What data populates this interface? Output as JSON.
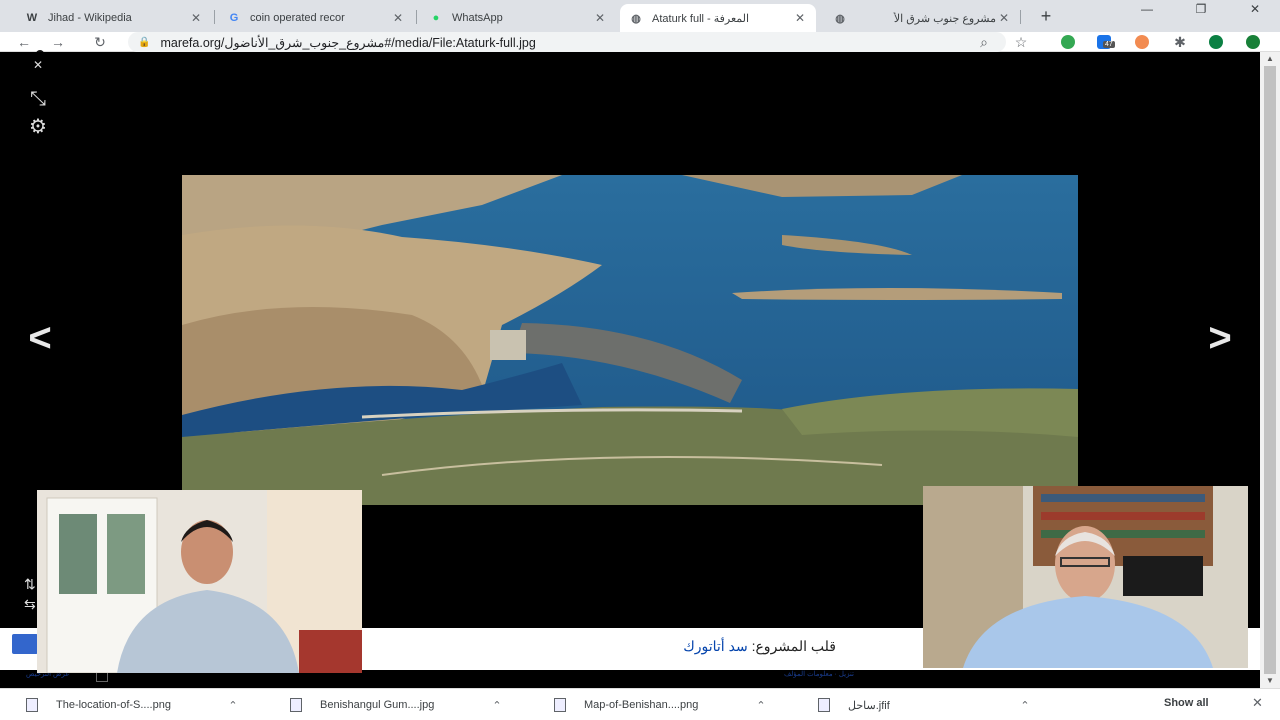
{
  "tabs": [
    {
      "label": "Jihad - Wikipedia",
      "icon": "wikipedia-icon"
    },
    {
      "label": "coin operated recor",
      "icon": "google-icon"
    },
    {
      "label": "WhatsApp",
      "icon": "whatsapp-icon"
    },
    {
      "label": "Ataturk full - المعرفة",
      "icon": "globe-icon"
    },
    {
      "label": "مشروع جنوب شرق الأ",
      "icon": "globe-icon"
    }
  ],
  "toolbar": {
    "url": "marefa.org/مشروع_جنوب_شرق_الأناضول#/media/File:Ataturk-full.jpg",
    "extension_badge": "47"
  },
  "viewer": {
    "caption_label": "قلب المشروع:",
    "caption_link": "سد أتاتورك",
    "prev_label": "<",
    "next_label": ">",
    "note_left": "عرض الترخيص",
    "note_right": "تنزيل · معلومات المؤلف"
  },
  "downloads": [
    {
      "name": "The-location-of-S....png"
    },
    {
      "name": "Benishangul Gum....jpg"
    },
    {
      "name": "Map-of-Benishan....png"
    },
    {
      "name": "ساحل.jfif"
    }
  ],
  "download_bar": {
    "show_all": "Show all"
  },
  "colors": {
    "accent": "#3366cc",
    "link": "#0645ad",
    "water": "#1f5c8f"
  }
}
